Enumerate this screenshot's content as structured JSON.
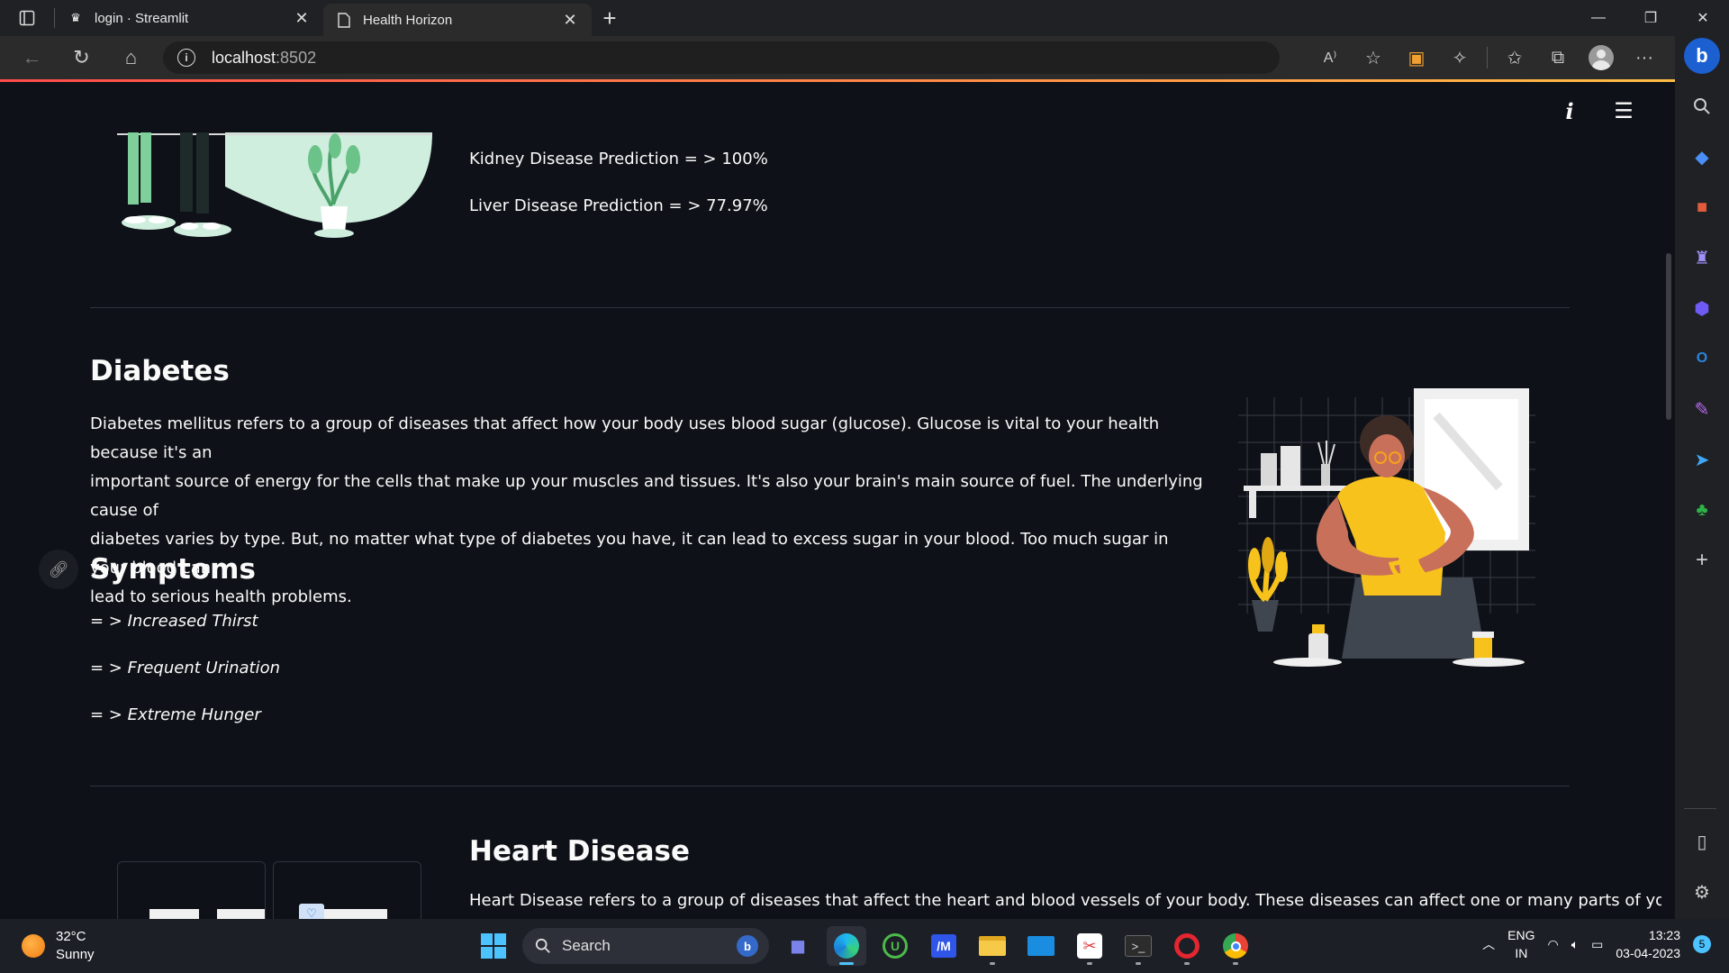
{
  "browser": {
    "tabs": [
      {
        "title": "login · Streamlit",
        "icon": "streamlit-crown-icon",
        "active": false
      },
      {
        "title": "Health Horizon",
        "icon": "page-icon",
        "active": true
      }
    ],
    "url_host": "localhost",
    "url_port": ":8502"
  },
  "page": {
    "predictions": [
      {
        "text": "Kidney Disease Prediction = > 100%"
      },
      {
        "text": "Liver Disease Prediction = > 77.97%"
      }
    ],
    "diabetes": {
      "heading": "Diabetes",
      "lines": [
        "Diabetes mellitus refers to a group of diseases that affect how your body uses blood sugar (glucose). Glucose is vital to your health because it's an",
        "important source of energy for the cells that make up your muscles and tissues. It's also your brain's main source of fuel. The underlying cause of",
        "diabetes varies by type. But, no matter what type of diabetes you have, it can lead to excess sugar in your blood. Too much sugar in your blood can",
        "lead to serious health problems."
      ]
    },
    "symptoms": {
      "heading": "Symptoms",
      "items": [
        "= > Increased Thirst",
        "= > Frequent Urination",
        "= > Extreme Hunger"
      ]
    },
    "heart": {
      "heading": "Heart Disease",
      "text": "Heart Disease refers to a group of diseases that affect the heart and blood vessels of your body. These diseases can affect one or many parts of your"
    }
  },
  "taskbar": {
    "weather_temp": "32°C",
    "weather_desc": "Sunny",
    "search_label": "Search",
    "lang_top": "ENG",
    "lang_bottom": "IN",
    "time": "13:23",
    "date": "03-04-2023",
    "notif_count": "5"
  },
  "colors": {
    "app_bg": "#0e1117",
    "accent_gradient_start": "#ff4b4b",
    "accent_gradient_end": "#ffbd45",
    "illustration_yellow": "#f7c21b",
    "illustration_skin": "#c9705a",
    "illustration_mint": "#cfeede"
  }
}
